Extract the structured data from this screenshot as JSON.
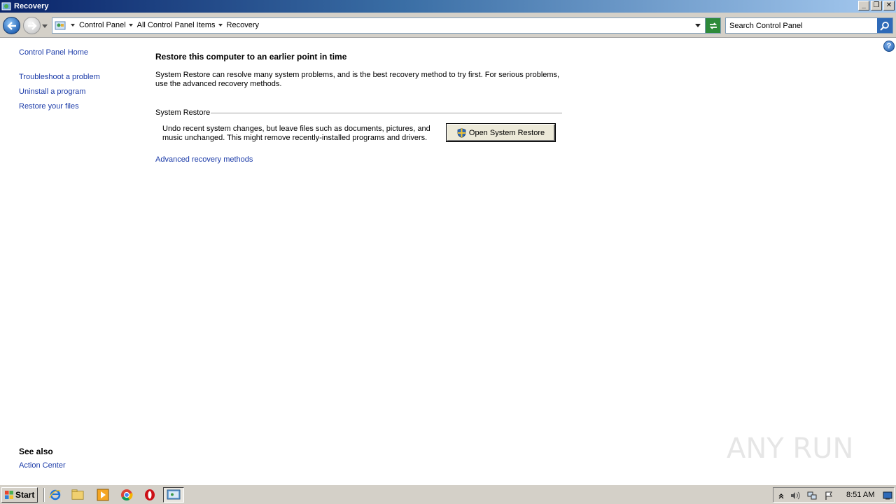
{
  "window": {
    "title": "Recovery"
  },
  "window_buttons": {
    "minimize": "_",
    "restore": "❐",
    "close": "✕"
  },
  "address": {
    "crumbs": [
      "Control Panel",
      "All Control Panel Items",
      "Recovery"
    ]
  },
  "search": {
    "placeholder": "Search Control Panel"
  },
  "left_nav": {
    "home": "Control Panel Home",
    "links": [
      "Troubleshoot a problem",
      "Uninstall a program",
      "Restore your files"
    ],
    "see_also_title": "See also",
    "see_also_links": [
      "Action Center"
    ]
  },
  "main": {
    "title": "Restore this computer to an earlier point in time",
    "description": "System Restore can resolve many system problems, and is the best recovery method to try first. For serious problems, use the advanced recovery methods.",
    "section_label": "System Restore",
    "section_description": "Undo recent system changes, but leave files such as documents, pictures, and music unchanged. This might remove recently-installed programs and drivers.",
    "open_button": "Open System Restore",
    "advanced_link": "Advanced recovery methods"
  },
  "help": {
    "glyph": "?"
  },
  "watermark": {
    "text": "ANY RUN"
  },
  "taskbar": {
    "start_label": "Start",
    "clock": "8:51 AM",
    "icons": [
      "ie-icon",
      "explorer-icon",
      "media-player-icon",
      "chrome-icon",
      "opera-icon",
      "control-panel-icon"
    ]
  },
  "colors": {
    "link": "#1a3aa8",
    "titlebar_start": "#0a246a",
    "taskbar": "#d4d0c8"
  }
}
